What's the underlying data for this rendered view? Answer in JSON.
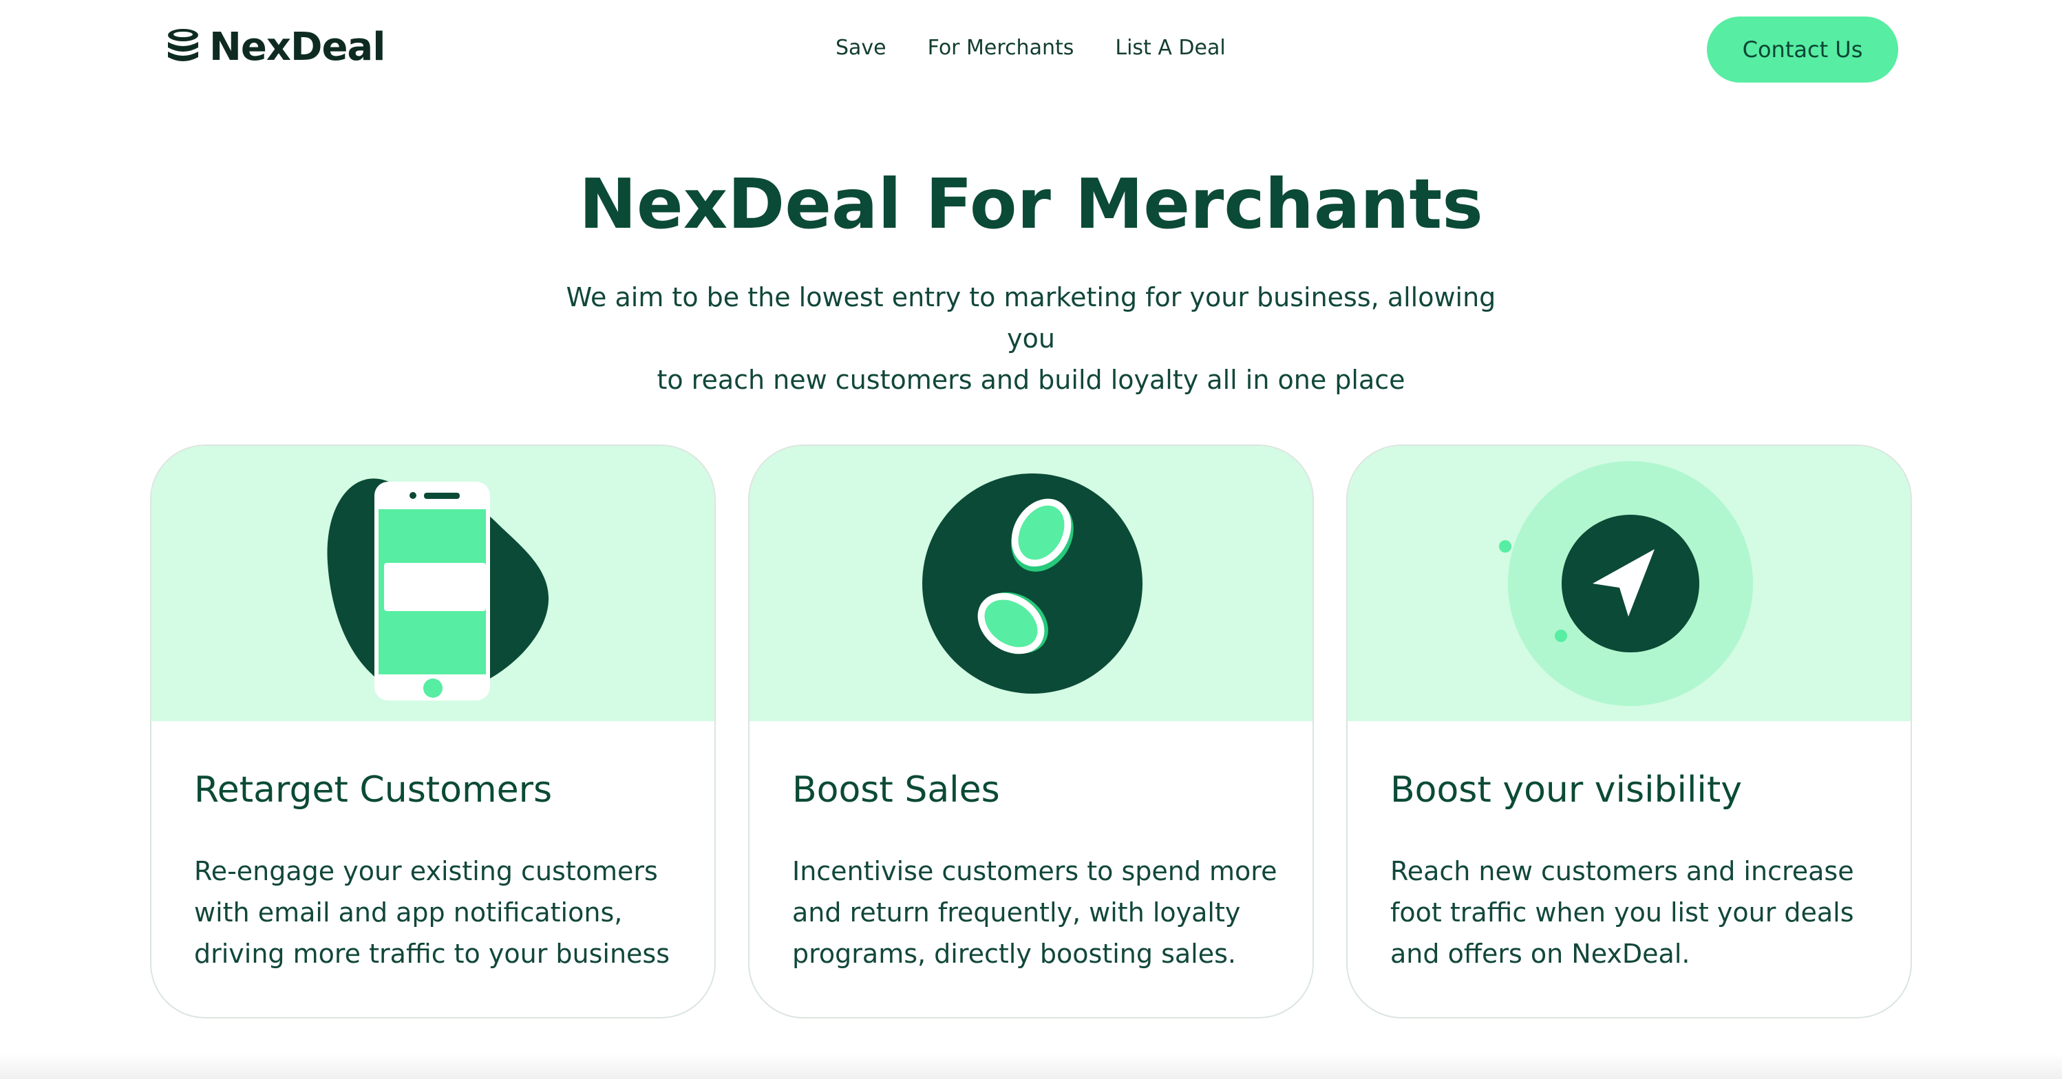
{
  "brand": {
    "name": "NexDeal"
  },
  "nav": {
    "items": [
      {
        "label": "Save"
      },
      {
        "label": "For Merchants"
      },
      {
        "label": "List A Deal"
      }
    ],
    "contact_label": "Contact Us"
  },
  "hero": {
    "title": "NexDeal For Merchants",
    "subtitle_line1": "We aim to be the lowest entry to marketing for your business, allowing you",
    "subtitle_line2": "to reach new customers and build loyalty all in one place"
  },
  "cards": [
    {
      "title": "Retarget Customers",
      "lines": [
        "Re-engage your existing customers",
        "with email and app notifications,",
        "driving more traffic to your business"
      ],
      "icon": "phone-notification-icon"
    },
    {
      "title": "Boost Sales",
      "lines": [
        "Incentivise customers to spend more",
        "and return frequently, with loyalty",
        "programs, directly boosting sales."
      ],
      "icon": "coins-icon"
    },
    {
      "title": "Boost your visibility",
      "lines": [
        "Reach new customers and increase",
        "foot traffic when you list your deals",
        "and offers on NexDeal."
      ],
      "icon": "navigation-arrow-icon"
    }
  ],
  "colors": {
    "accent": "#57eda2",
    "dark_green": "#0b4a36",
    "light_green": "#d4fbe4"
  }
}
